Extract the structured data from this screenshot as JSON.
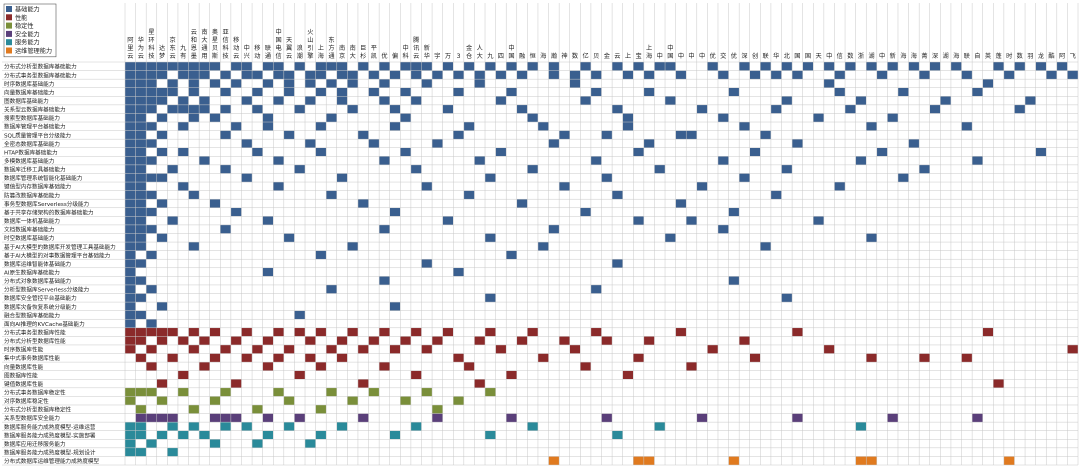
{
  "legend": [
    {
      "label": "基础能力",
      "color": "#3a5f8f"
    },
    {
      "label": "性能",
      "color": "#8b2a2a"
    },
    {
      "label": "稳定性",
      "color": "#7a8f3a"
    },
    {
      "label": "安全能力",
      "color": "#5a3f7a"
    },
    {
      "label": "服务能力",
      "color": "#2a8a9a"
    },
    {
      "label": "运维管理能力",
      "color": "#e07a1f"
    }
  ],
  "chart_data": {
    "type": "heatmap",
    "columns": [
      "阿里云",
      "华为云",
      "星环科技",
      "达梦",
      "京东云",
      "九有",
      "云和恩墨",
      "南大通用",
      "奥星贝斯",
      "亚信科技",
      "移动云",
      "中兴",
      "移动",
      "联通",
      "中国电信",
      "天翼云",
      "浪潮",
      "火山引擎",
      "上海",
      "东方通",
      "南京",
      "南大",
      "巨杉",
      "平凯",
      "优",
      "偏",
      "中科",
      "腾讯云",
      "新华",
      "宇",
      "万",
      "3",
      "金仓",
      "人大",
      "九",
      "四",
      "中国",
      "融",
      "恒",
      "海",
      "瀚",
      "神",
      "数",
      "亿",
      "贝",
      "金",
      "云",
      "上",
      "宝",
      "上海",
      "中",
      "中国",
      "中",
      "中",
      "中",
      "优",
      "交",
      "优",
      "深",
      "创",
      "联",
      "华",
      "北",
      "国",
      "国",
      "天",
      "中",
      "信",
      "数",
      "浙",
      "湖",
      "中",
      "新",
      "海",
      "海",
      "菁",
      "深",
      "湖",
      "海",
      "联",
      "自",
      "英",
      "蓬",
      "时",
      "数",
      "羽",
      "龙",
      "酷",
      "阿",
      "飞"
    ],
    "rows": [
      {
        "label": "分布式分析型数据库基础能力",
        "category": 0,
        "cells": [
          0,
          1,
          2,
          3,
          4,
          5,
          6,
          7,
          8,
          10,
          11,
          13,
          14,
          16,
          18,
          19,
          20,
          22,
          24,
          26,
          27,
          28,
          30,
          32,
          34,
          36,
          38,
          40,
          43,
          46,
          48,
          50,
          51,
          55,
          58,
          60,
          62,
          64,
          66,
          68,
          70,
          72,
          74,
          76,
          78,
          82,
          84,
          86,
          88,
          90
        ]
      },
      {
        "label": "分布式事务型数据库基础能力",
        "category": 0,
        "cells": [
          0,
          1,
          2,
          3,
          5,
          6,
          7,
          9,
          11,
          12,
          14,
          15,
          17,
          18,
          20,
          21,
          23,
          25,
          27,
          29,
          31,
          33,
          35,
          37,
          40,
          42,
          44,
          47,
          49,
          52,
          56,
          59,
          61,
          63,
          67,
          71,
          75,
          79,
          83,
          87,
          89
        ]
      },
      {
        "label": "时序数据库基础能力",
        "category": 0,
        "cells": [
          0,
          1,
          2,
          4,
          6,
          8,
          10,
          13,
          15,
          17,
          19,
          21,
          24,
          28,
          33,
          42,
          66,
          81
        ]
      },
      {
        "label": "向量数据库基础能力",
        "category": 0,
        "cells": [
          0,
          1,
          2,
          3,
          4,
          6,
          9,
          12,
          15,
          18,
          20,
          23,
          26,
          31,
          36,
          44,
          49,
          57,
          67,
          73,
          80
        ]
      },
      {
        "label": "图数据库基础能力",
        "category": 0,
        "cells": [
          0,
          1,
          2,
          3,
          5,
          7,
          11,
          14,
          17,
          20,
          24,
          27,
          35,
          43,
          51,
          62,
          69,
          77,
          85
        ]
      },
      {
        "label": "关系型云数据库基础能力",
        "category": 0,
        "cells": [
          0,
          1,
          2,
          4,
          5,
          6,
          7,
          9,
          12,
          16,
          21,
          25,
          30,
          37,
          46,
          54,
          61,
          68,
          76,
          84
        ]
      },
      {
        "label": "搜索型数据库基础能力",
        "category": 0,
        "cells": [
          0,
          1,
          3,
          6,
          8,
          13,
          19,
          26,
          38,
          47,
          56,
          65,
          72
        ]
      },
      {
        "label": "数据库管理平台基础能力",
        "category": 0,
        "cells": [
          0,
          1,
          2,
          5,
          10,
          13,
          18,
          25,
          32,
          39,
          47,
          58,
          70,
          79
        ]
      },
      {
        "label": "SQL质量管理平台分级能力",
        "category": 0,
        "cells": [
          0,
          1,
          3,
          9,
          15,
          22,
          31,
          41,
          45,
          52,
          53,
          60
        ]
      },
      {
        "label": "全密态数据库基础能力",
        "category": 0,
        "cells": [
          0,
          1,
          2,
          11,
          17,
          23,
          29,
          40,
          49,
          63,
          74
        ]
      },
      {
        "label": "HTAP数据库基础能力",
        "category": 0,
        "cells": [
          0,
          1,
          3,
          5,
          12,
          18,
          26,
          35,
          48,
          59,
          71,
          86
        ]
      },
      {
        "label": "多模数据库基础能力",
        "category": 0,
        "cells": [
          0,
          1,
          2,
          7,
          14,
          24,
          33,
          44,
          56,
          69,
          80,
          90
        ]
      },
      {
        "label": "数据库迁移工具基础能力",
        "category": 0,
        "cells": [
          0,
          1,
          4,
          9,
          16,
          27,
          38,
          50,
          62,
          75
        ]
      },
      {
        "label": "数据库管理系统智能化基础能力",
        "category": 0,
        "cells": [
          0,
          1,
          2,
          3,
          11,
          20,
          34,
          45,
          58,
          73
        ]
      },
      {
        "label": "键值型内存数据库基础能力",
        "category": 0,
        "cells": [
          0,
          1,
          5,
          14,
          28,
          41,
          54,
          67
        ]
      },
      {
        "label": "防篡改数据库基础能力",
        "category": 0,
        "cells": [
          0,
          1,
          2,
          6,
          19,
          32,
          46,
          61
        ]
      },
      {
        "label": "事务型数据库Serverless分级能力",
        "category": 0,
        "cells": [
          0,
          1,
          3,
          8,
          22,
          37,
          52
        ]
      },
      {
        "label": "基于共享存储架构的数据库基础能力",
        "category": 0,
        "cells": [
          0,
          1,
          2,
          10,
          25,
          43,
          57
        ]
      },
      {
        "label": "数据库一体机基础能力",
        "category": 0,
        "cells": [
          0,
          1,
          4,
          13,
          30,
          48,
          53,
          65
        ]
      },
      {
        "label": "文档数据库基础能力",
        "category": 0,
        "cells": [
          0,
          1,
          2,
          9,
          24,
          40,
          56
        ]
      },
      {
        "label": "时空数据库基础能力",
        "category": 0,
        "cells": [
          0,
          1,
          3,
          15,
          34,
          51,
          70
        ]
      },
      {
        "label": "基于AI大模型的数据库开发管理工具基础能力",
        "category": 0,
        "cells": [
          0,
          1,
          6,
          21,
          39,
          60
        ]
      },
      {
        "label": "基于AI大模型的对事数据管理平台基础能力",
        "category": 0,
        "cells": [
          0,
          2,
          18,
          36
        ]
      },
      {
        "label": "数据库运维智能体基础能力",
        "category": 0,
        "cells": [
          0,
          1,
          28,
          46
        ]
      },
      {
        "label": "AI原生数据库基础能力",
        "category": 0,
        "cells": [
          0,
          13,
          31
        ]
      },
      {
        "label": "分布式对象数据库基础能力",
        "category": 0,
        "cells": [
          0,
          1,
          24,
          57
        ]
      },
      {
        "label": "分析型数据库Serverless分级能力",
        "category": 0,
        "cells": [
          0,
          2,
          19,
          44
        ]
      },
      {
        "label": "数据库安全管控平台基础能力",
        "category": 0,
        "cells": [
          0,
          1,
          34,
          62
        ]
      },
      {
        "label": "数据库灾备恢复系统分级能力",
        "category": 0,
        "cells": [
          0,
          3,
          25
        ]
      },
      {
        "label": "融合型数据库基础能力",
        "category": 0,
        "cells": [
          0,
          1,
          16
        ]
      },
      {
        "label": "面向AI推理的KVCache基础能力",
        "category": 0,
        "cells": [
          0,
          2
        ]
      },
      {
        "label": "分布式事务型数据库性能",
        "category": 1,
        "cells": [
          0,
          1,
          2,
          3,
          4,
          6,
          8,
          11,
          14,
          16,
          18,
          21,
          24,
          27,
          30,
          34,
          38,
          44,
          52,
          63,
          81
        ]
      },
      {
        "label": "分布式分析型数据库性能",
        "category": 1,
        "cells": [
          0,
          1,
          3,
          5,
          7,
          10,
          13,
          17,
          20,
          23,
          26,
          29,
          33,
          37,
          41,
          45,
          49,
          58
        ]
      },
      {
        "label": "时序数据库性能",
        "category": 1,
        "cells": [
          0,
          2,
          6,
          9,
          12,
          15,
          19,
          22,
          25,
          28,
          35,
          42,
          55,
          66,
          89
        ]
      },
      {
        "label": "集中式事务数据库性能",
        "category": 1,
        "cells": [
          1,
          4,
          8,
          11,
          14,
          17,
          20,
          31,
          39,
          48,
          59,
          70,
          75,
          79
        ]
      },
      {
        "label": "向量数据库性能",
        "category": 1,
        "cells": [
          2,
          7,
          13,
          18,
          24,
          32,
          43,
          53
        ]
      },
      {
        "label": "图数据库性能",
        "category": 1,
        "cells": [
          5,
          16,
          27,
          36,
          47
        ]
      },
      {
        "label": "键值数据库性能",
        "category": 1,
        "cells": [
          3,
          10,
          22,
          33,
          82
        ]
      },
      {
        "label": "分布式事务数据库稳定性",
        "category": 2,
        "cells": [
          0,
          1,
          2,
          5,
          9,
          14,
          19,
          23,
          28,
          34
        ]
      },
      {
        "label": "对序数据库稳定性",
        "category": 2,
        "cells": [
          0,
          3,
          8,
          15,
          21,
          26,
          31
        ]
      },
      {
        "label": "分布式分析型数据库稳定性",
        "category": 2,
        "cells": [
          1,
          6,
          12,
          18,
          29
        ]
      },
      {
        "label": "关系型数据库安全能力",
        "category": 3,
        "cells": [
          1,
          2,
          3,
          4,
          8,
          9,
          10,
          13,
          16,
          22,
          29,
          36,
          45,
          54,
          63,
          72,
          80
        ]
      },
      {
        "label": "数据库服务能力成熟度模型-运维运营",
        "category": 4,
        "cells": [
          0,
          1,
          4,
          6,
          9,
          11,
          15,
          20,
          27,
          38,
          50,
          69
        ]
      },
      {
        "label": "数据库服务能力成熟度模型-实施部署",
        "category": 4,
        "cells": [
          0,
          1,
          3,
          5,
          7,
          13,
          18,
          25,
          34,
          46
        ]
      },
      {
        "label": "数据库应用迁移服务能力",
        "category": 4,
        "cells": [
          0,
          2,
          8,
          12,
          17
        ]
      },
      {
        "label": "数据库服务能力成熟度模型-规划设计",
        "category": 4,
        "cells": [
          0,
          1,
          4
        ]
      },
      {
        "label": "分布式数据库运维管理能力成熟度模型",
        "category": 5,
        "cells": [
          40,
          48,
          49,
          57,
          69,
          70,
          83,
          90
        ]
      }
    ]
  }
}
